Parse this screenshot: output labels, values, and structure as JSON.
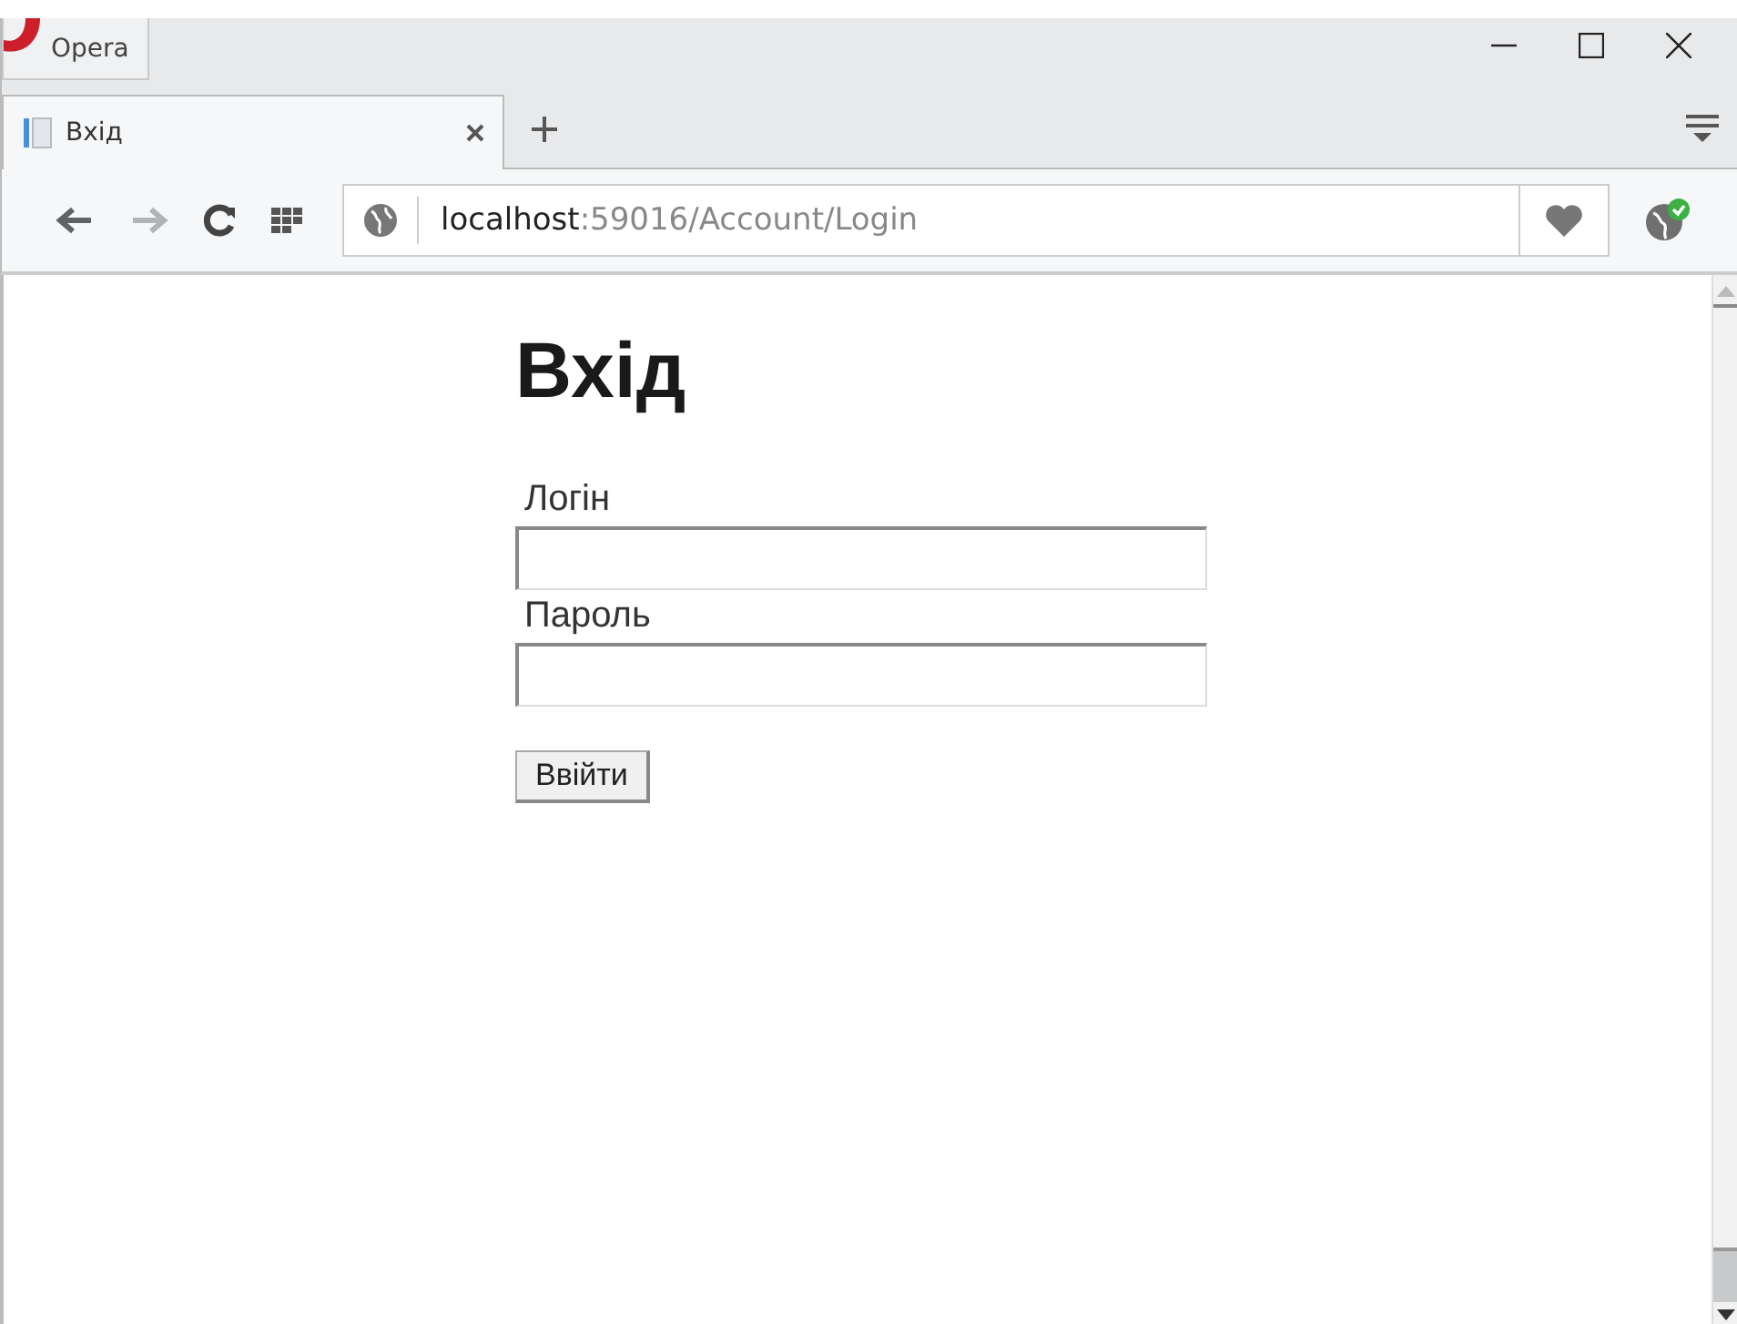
{
  "window": {
    "app_button": "Opera"
  },
  "tabs": [
    {
      "title": "Вхід",
      "selected": true
    }
  ],
  "address": {
    "host": "localhost",
    "path": ":59016/Account/Login"
  },
  "page": {
    "heading": "Вхід",
    "fields": [
      {
        "label": "Логін"
      },
      {
        "label": "Пароль"
      }
    ],
    "submit": "Ввійти"
  }
}
